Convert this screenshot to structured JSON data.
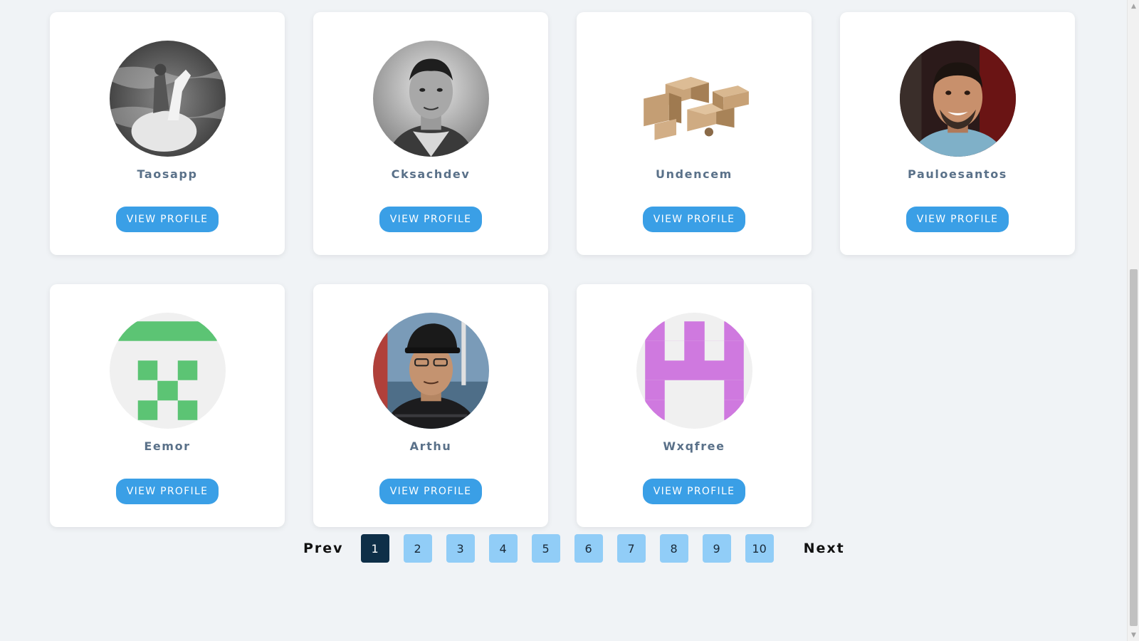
{
  "profiles": [
    {
      "name": "Taosapp",
      "button_label": "VIEW PROFILE",
      "avatar": "grayscale-photo-rider-on-horse-in-water"
    },
    {
      "name": "Cksachdev",
      "button_label": "VIEW PROFILE",
      "avatar": "grayscale-portrait-man"
    },
    {
      "name": "Undencem",
      "button_label": "VIEW PROFILE",
      "avatar": "cardboard-boxes-photo"
    },
    {
      "name": "Pauloesantos",
      "button_label": "VIEW PROFILE",
      "avatar": "color-portrait-smiling-man"
    },
    {
      "name": "Eemor",
      "button_label": "VIEW PROFILE",
      "avatar": "identicon-green"
    },
    {
      "name": "Arthu",
      "button_label": "VIEW PROFILE",
      "avatar": "color-photo-man-in-cap"
    },
    {
      "name": "Wxqfree",
      "button_label": "VIEW PROFILE",
      "avatar": "identicon-purple"
    }
  ],
  "pagination": {
    "prev_label": "Prev",
    "next_label": "Next",
    "pages": [
      "1",
      "2",
      "3",
      "4",
      "5",
      "6",
      "7",
      "8",
      "9",
      "10"
    ],
    "current_page": "1"
  },
  "colors": {
    "background": "#f0f3f6",
    "card": "#ffffff",
    "name_text": "#5a7189",
    "button": "#3a9fe6",
    "page_button": "#91cdf7",
    "page_active": "#0e2f48",
    "identicon_green": "#5cc474",
    "identicon_purple": "#cf79df"
  },
  "icons": {
    "scroll_up": "▲",
    "scroll_down": "▼"
  }
}
